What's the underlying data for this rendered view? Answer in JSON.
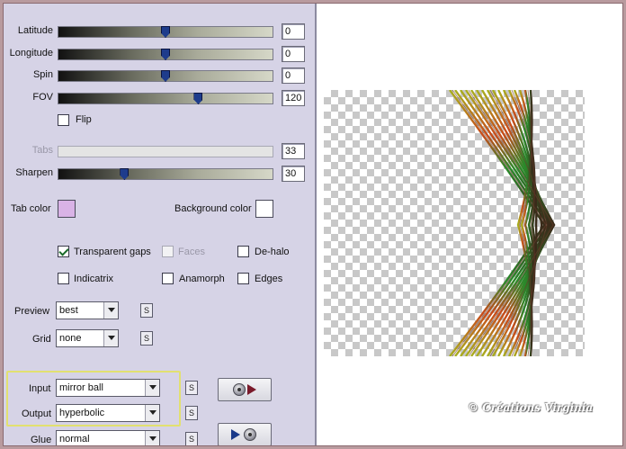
{
  "sliders": [
    {
      "key": "latitude",
      "label": "Latitude",
      "value": "0",
      "fraction": 0.5
    },
    {
      "key": "longitude",
      "label": "Longitude",
      "value": "0",
      "fraction": 0.5
    },
    {
      "key": "spin",
      "label": "Spin",
      "value": "0",
      "fraction": 0.5
    },
    {
      "key": "fov",
      "label": "FOV",
      "value": "120",
      "fraction": 0.66
    },
    {
      "key": "tabs",
      "label": "Tabs",
      "value": "33",
      "fraction": null,
      "disabled": true
    },
    {
      "key": "sharpen",
      "label": "Sharpen",
      "value": "30",
      "fraction": 0.3
    }
  ],
  "flip": {
    "label": "Flip",
    "checked": false
  },
  "tab_color": {
    "label": "Tab color",
    "color": "#d9b3e6"
  },
  "background_color": {
    "label": "Background color",
    "color": "#ffffff"
  },
  "checkboxes": {
    "transparent_gaps": {
      "label": "Transparent gaps",
      "checked": true
    },
    "faces": {
      "label": "Faces",
      "checked": false,
      "disabled": true
    },
    "de_halo": {
      "label": "De-halo",
      "checked": false
    },
    "indicatrix": {
      "label": "Indicatrix",
      "checked": false
    },
    "anamorph": {
      "label": "Anamorph",
      "checked": false
    },
    "edges": {
      "label": "Edges",
      "checked": false
    }
  },
  "selects": {
    "preview": {
      "label": "Preview",
      "value": "best"
    },
    "grid": {
      "label": "Grid",
      "value": "none"
    },
    "input": {
      "label": "Input",
      "value": "mirror ball"
    },
    "output": {
      "label": "Output",
      "value": "hyperbolic"
    },
    "glue": {
      "label": "Glue",
      "value": "normal"
    }
  },
  "s_button_label": "S",
  "watermark": "© Créations Virginia",
  "colors": {
    "panel_bg": "#d6d3e6",
    "highlight": "#e2e070",
    "thumb": "#1e3c8c"
  },
  "icons": {
    "reverse_transform": "disc-with-red-arrow-icon",
    "forward_transform": "blue-arrow-with-disc-icon"
  }
}
